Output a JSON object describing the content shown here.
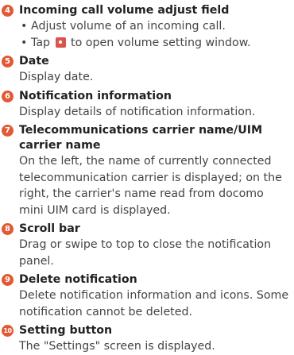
{
  "items": [
    {
      "number": "4",
      "title": "Incoming call volume adjust field",
      "bullets": [
        "Adjust volume of an incoming call.",
        {
          "before": "Tap",
          "icon": "settings-gear-icon",
          "after": "to open volume setting window."
        }
      ]
    },
    {
      "number": "5",
      "title": "Date",
      "desc": "Display date."
    },
    {
      "number": "6",
      "title": "Notification information",
      "desc": "Display details of notification information."
    },
    {
      "number": "7",
      "title": "Telecommunications carrier name/UIM carrier name",
      "desc": "On the left, the name of currently connected telecommunication carrier is displayed; on the right, the carrier's name read from docomo mini UIM card is displayed."
    },
    {
      "number": "8",
      "title": "Scroll bar",
      "desc": "Drag or swipe to top to close the notification panel."
    },
    {
      "number": "9",
      "title": "Delete notification",
      "desc": "Delete notification information and icons. Some notification cannot be deleted."
    },
    {
      "number": "10",
      "title": "Setting button",
      "desc": "The \"Settings\" screen is displayed."
    }
  ],
  "colors": {
    "badge": "#e25a35",
    "heading": "#222222",
    "text": "#444444",
    "icon": "#d9534f"
  }
}
